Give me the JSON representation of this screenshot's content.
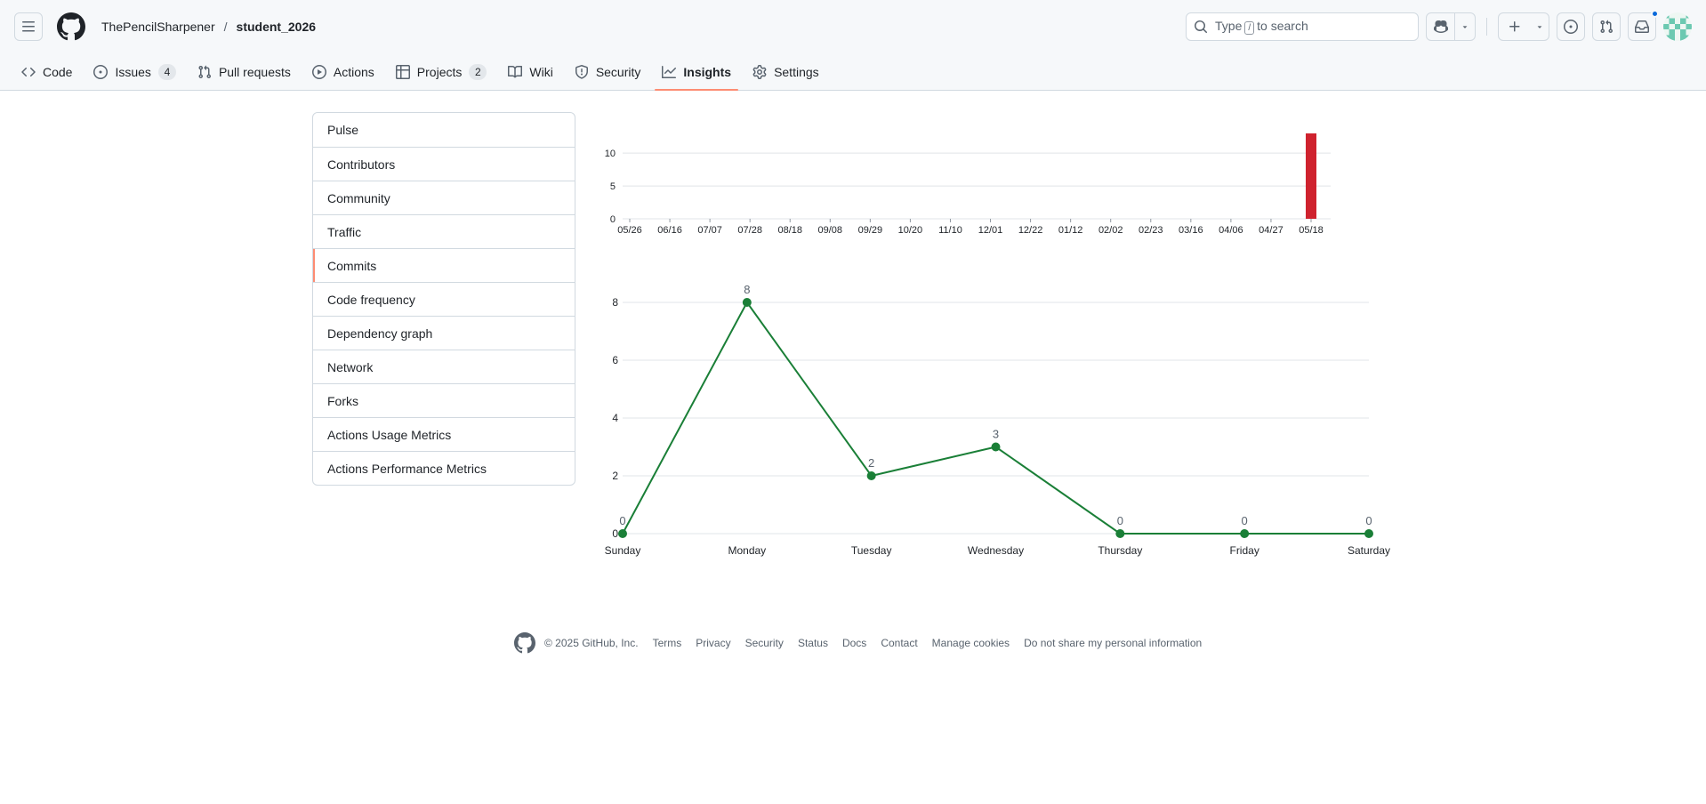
{
  "header": {
    "owner": "ThePencilSharpener",
    "separator": "/",
    "repo": "student_2026",
    "search_prefix": "Type",
    "search_key": "/",
    "search_suffix": "to search"
  },
  "tabs": [
    {
      "label": "Code",
      "icon": "code-icon"
    },
    {
      "label": "Issues",
      "icon": "issue-opened-icon",
      "count": "4"
    },
    {
      "label": "Pull requests",
      "icon": "git-pull-request-icon"
    },
    {
      "label": "Actions",
      "icon": "play-icon"
    },
    {
      "label": "Projects",
      "icon": "table-icon",
      "count": "2"
    },
    {
      "label": "Wiki",
      "icon": "book-icon"
    },
    {
      "label": "Security",
      "icon": "shield-icon"
    },
    {
      "label": "Insights",
      "icon": "graph-icon",
      "active": true
    },
    {
      "label": "Settings",
      "icon": "gear-icon"
    }
  ],
  "sidebar": {
    "items": [
      {
        "label": "Pulse"
      },
      {
        "label": "Contributors"
      },
      {
        "label": "Community"
      },
      {
        "label": "Traffic"
      },
      {
        "label": "Commits",
        "active": true
      },
      {
        "label": "Code frequency"
      },
      {
        "label": "Dependency graph"
      },
      {
        "label": "Network"
      },
      {
        "label": "Forks"
      },
      {
        "label": "Actions Usage Metrics"
      },
      {
        "label": "Actions Performance Metrics"
      }
    ]
  },
  "chart_data": [
    {
      "type": "bar",
      "title": "",
      "categories": [
        "05/26",
        "06/16",
        "07/07",
        "07/28",
        "08/18",
        "09/08",
        "09/29",
        "10/20",
        "11/10",
        "12/01",
        "12/22",
        "01/12",
        "02/02",
        "02/23",
        "03/16",
        "04/06",
        "04/27",
        "05/18"
      ],
      "values": [
        0,
        0,
        0,
        0,
        0,
        0,
        0,
        0,
        0,
        0,
        0,
        0,
        0,
        0,
        0,
        0,
        0,
        13
      ],
      "yticks": [
        0,
        5,
        10
      ],
      "ylim": [
        0,
        13
      ],
      "bar_color": "#cf222e",
      "grid": true
    },
    {
      "type": "line",
      "title": "",
      "categories": [
        "Sunday",
        "Monday",
        "Tuesday",
        "Wednesday",
        "Thursday",
        "Friday",
        "Saturday"
      ],
      "values": [
        0,
        8,
        2,
        3,
        0,
        0,
        0
      ],
      "yticks": [
        0,
        2,
        4,
        6,
        8
      ],
      "ylim": [
        0,
        8
      ],
      "line_color": "#1a7f37",
      "grid": true,
      "data_labels": true
    }
  ],
  "footer": {
    "copyright": "© 2025 GitHub, Inc.",
    "links": [
      "Terms",
      "Privacy",
      "Security",
      "Status",
      "Docs",
      "Contact",
      "Manage cookies",
      "Do not share my personal information"
    ]
  }
}
